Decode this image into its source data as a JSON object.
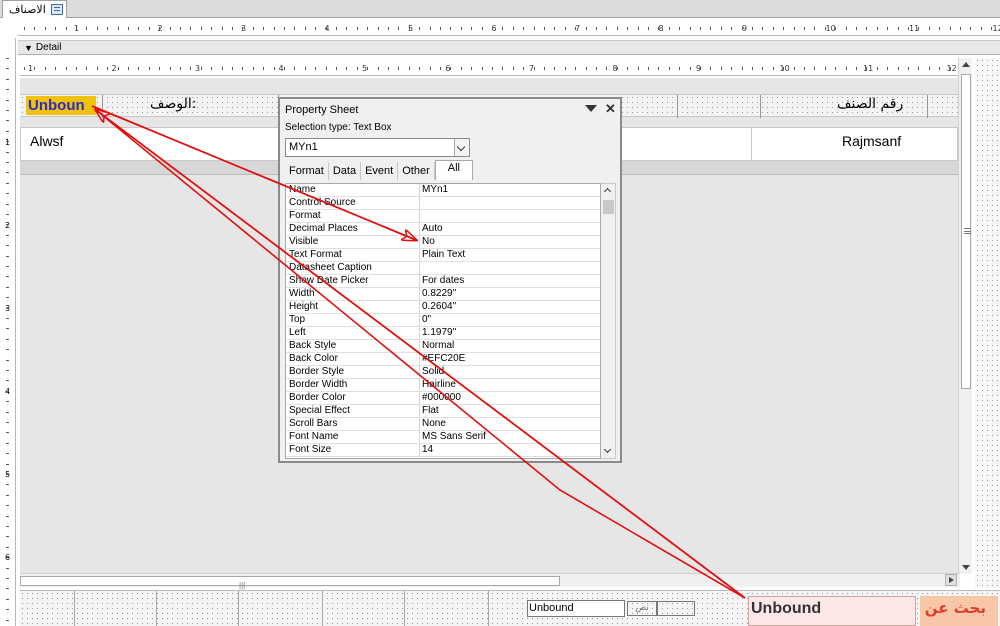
{
  "tab": {
    "title": "الاصناف"
  },
  "section": {
    "label": "Detail"
  },
  "ruler_top": [
    "1",
    "2",
    "3",
    "4",
    "5",
    "6",
    "7",
    "8",
    "9",
    "10",
    "11",
    "12",
    "13"
  ],
  "ruler_inner": [
    "1",
    "2",
    "3",
    "4",
    "5",
    "6",
    "7",
    "8",
    "9",
    "10",
    "11",
    "12"
  ],
  "ruler_left": [
    "1",
    "2",
    "3",
    "4",
    "5",
    "6"
  ],
  "form": {
    "field_unbound": "Unboun",
    "label_desc": "الوصف:",
    "label_num": "رقم الصنف",
    "value_alwsf": "Alwsf",
    "value_rajmsanf": "Rajmsanf"
  },
  "property_sheet": {
    "title": "Property Sheet",
    "selection_type": "Selection type:  Text Box",
    "selected_control": "MYn1",
    "tabs": [
      "Format",
      "Data",
      "Event",
      "Other",
      "All"
    ],
    "active_tab": "All",
    "rows": [
      {
        "name": "Name",
        "value": "MYn1"
      },
      {
        "name": "Control Source",
        "value": ""
      },
      {
        "name": "Format",
        "value": ""
      },
      {
        "name": "Decimal Places",
        "value": "Auto"
      },
      {
        "name": "Visible",
        "value": "No"
      },
      {
        "name": "Text Format",
        "value": "Plain Text"
      },
      {
        "name": "Datasheet Caption",
        "value": ""
      },
      {
        "name": "Show Date Picker",
        "value": "For dates"
      },
      {
        "name": "Width",
        "value": "0.8229\""
      },
      {
        "name": "Height",
        "value": "0.2604\""
      },
      {
        "name": "Top",
        "value": "0\""
      },
      {
        "name": "Left",
        "value": "1.1979\""
      },
      {
        "name": "Back Style",
        "value": "Normal"
      },
      {
        "name": "Back Color",
        "value": "#EFC20E"
      },
      {
        "name": "Border Style",
        "value": "Solid"
      },
      {
        "name": "Border Width",
        "value": "Hairline"
      },
      {
        "name": "Border Color",
        "value": "#000000"
      },
      {
        "name": "Special Effect",
        "value": "Flat"
      },
      {
        "name": "Scroll Bars",
        "value": "None"
      },
      {
        "name": "Font Name",
        "value": "MS Sans Serif"
      },
      {
        "name": "Font Size",
        "value": "14"
      }
    ]
  },
  "bottom": {
    "small_unbound": "Unbound",
    "small_label": "نص",
    "big_unbound": "Unbound",
    "search_label": "بحث عن"
  },
  "colors": {
    "field_highlight": "#EFC20E",
    "annotation_arrow": "#E01010",
    "search_label_bg": "#F7C7A8"
  },
  "icons": {
    "tab": "form-icon",
    "section": "section-marker-icon"
  }
}
